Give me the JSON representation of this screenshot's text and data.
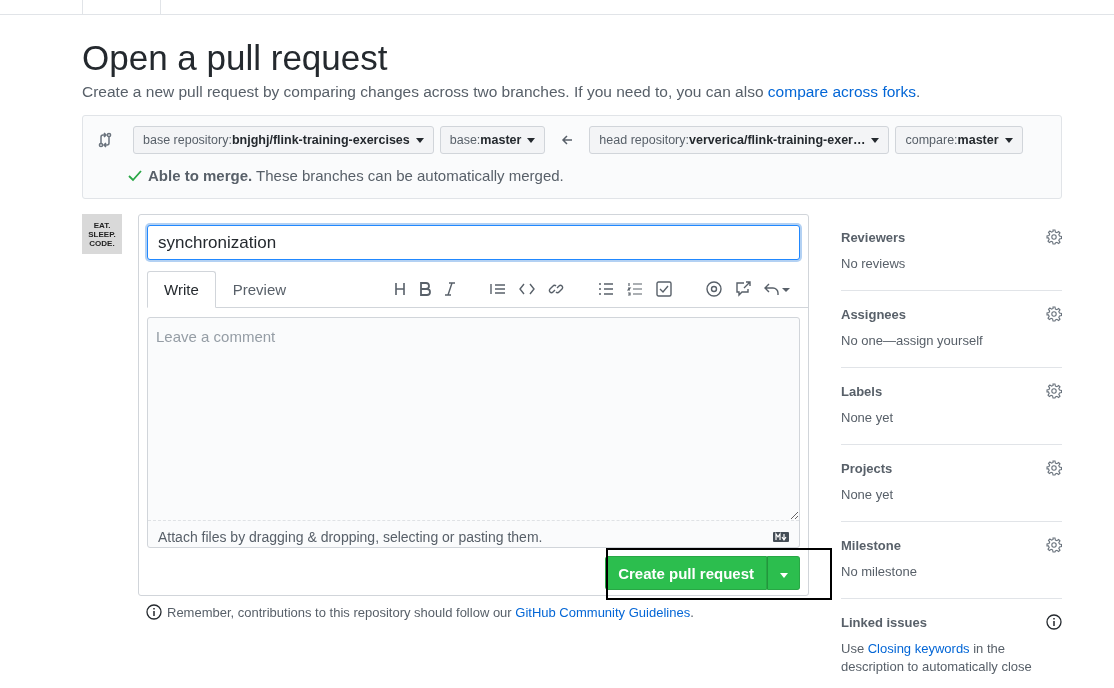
{
  "page": {
    "title": "Open a pull request",
    "subtitle_text": "Create a new pull request by comparing changes across two branches. If you need to, you can also ",
    "subtitle_link": "compare across forks",
    "subtitle_end": "."
  },
  "compare": {
    "selectors": [
      {
        "label": "base repository: ",
        "value": "bnjghj/flink-training-exercises"
      },
      {
        "label": "base: ",
        "value": "master"
      },
      {
        "label": "head repository: ",
        "value": "ververica/flink-training-exer…"
      },
      {
        "label": "compare: ",
        "value": "master"
      }
    ],
    "merge_status": "**Able to merge.** These branches can be automatically merged."
  },
  "avatar": {
    "lines": [
      "EAT.",
      "SLEEP.",
      "CODE."
    ]
  },
  "form": {
    "title_value": "synchronization",
    "tabs": [
      {
        "label": "Write",
        "selected": true
      },
      {
        "label": "Preview",
        "selected": false
      }
    ],
    "comment_placeholder": "Leave a comment",
    "attach_note": "Attach files by dragging & dropping, selecting or pasting them.",
    "submit": "Create pull request"
  },
  "footer": {
    "text": "Remember, contributions to this repository should follow our ",
    "link": "GitHub Community Guidelines",
    "end": "."
  },
  "sidebar": [
    {
      "title": "Reviewers",
      "kind": "gear",
      "value": "No reviews"
    },
    {
      "title": "Assignees",
      "kind": "gear",
      "value": "No one—assign yourself"
    },
    {
      "title": "Labels",
      "kind": "gear",
      "value": "None yet"
    },
    {
      "title": "Projects",
      "kind": "gear",
      "value": "None yet"
    },
    {
      "title": "Milestone",
      "kind": "gear",
      "value": "No milestone"
    },
    {
      "title": "Linked issues",
      "kind": "info",
      "value": "Use ",
      "link": "Closing keywords",
      "value_end": " in the description to automatically close"
    }
  ]
}
